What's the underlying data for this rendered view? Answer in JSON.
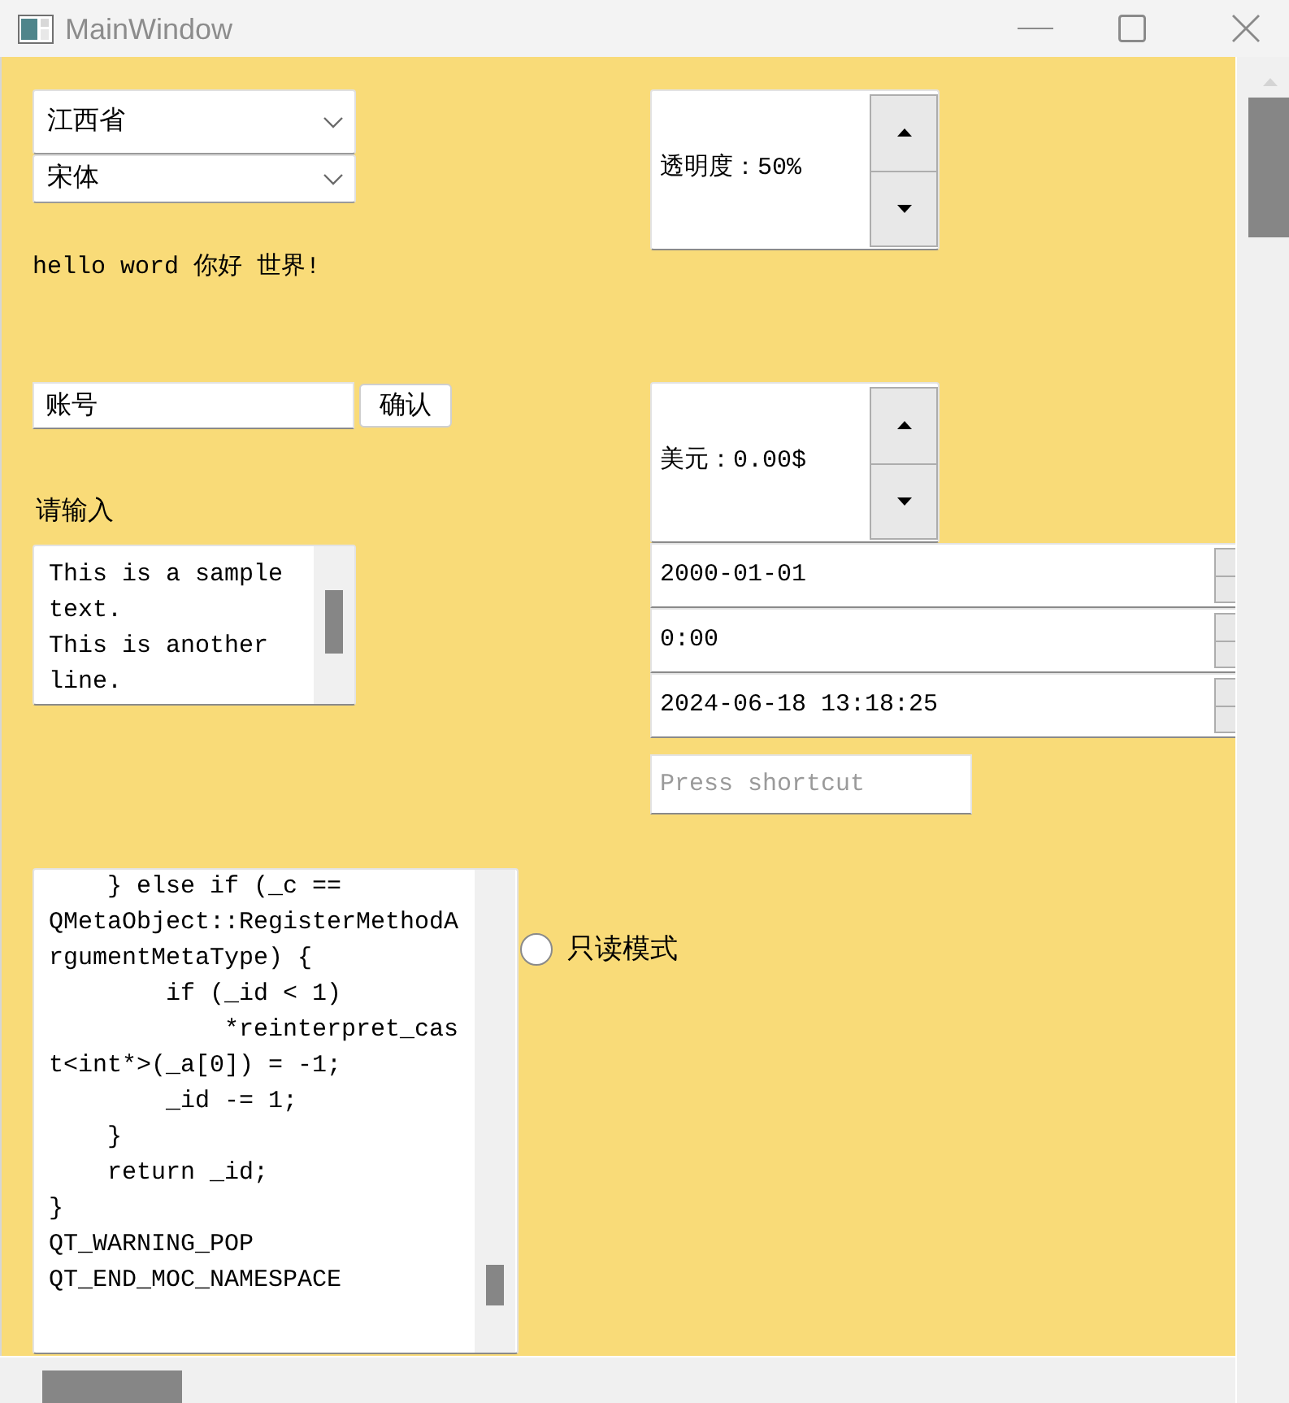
{
  "window": {
    "title": "MainWindow"
  },
  "combos": [
    {
      "value": "江西省"
    },
    {
      "value": "宋体"
    }
  ],
  "greeting": "hello word 你好 世界!",
  "account": {
    "value": "账号",
    "button": "确认"
  },
  "prompt": "请输入",
  "text_edit": {
    "lines": [
      "This is a sample text.",
      "This is another line."
    ]
  },
  "spin_boxes": [
    {
      "value": "透明度：50%"
    },
    {
      "value": "美元：0.00$"
    }
  ],
  "date_edits": [
    {
      "value": "2000-01-01"
    },
    {
      "value": "0:00"
    },
    {
      "value": "2024-06-18 13:18:25"
    }
  ],
  "shortcut_field": {
    "placeholder": "Press shortcut"
  },
  "code_edit": {
    "lines": [
      "    } else if (_c ==",
      "QMetaObject::RegisterMethodA",
      "rgumentMetaType) {",
      "        if (_id < 1)",
      "            *reinterpret_cas",
      "t<int*>(_a[0]) = -1;",
      "        _id -= 1;",
      "    }",
      "    return _id;",
      "}",
      "QT_WARNING_POP",
      "QT_END_MOC_NAMESPACE"
    ]
  },
  "read_only_radio": {
    "label": "只读模式",
    "checked": false
  }
}
